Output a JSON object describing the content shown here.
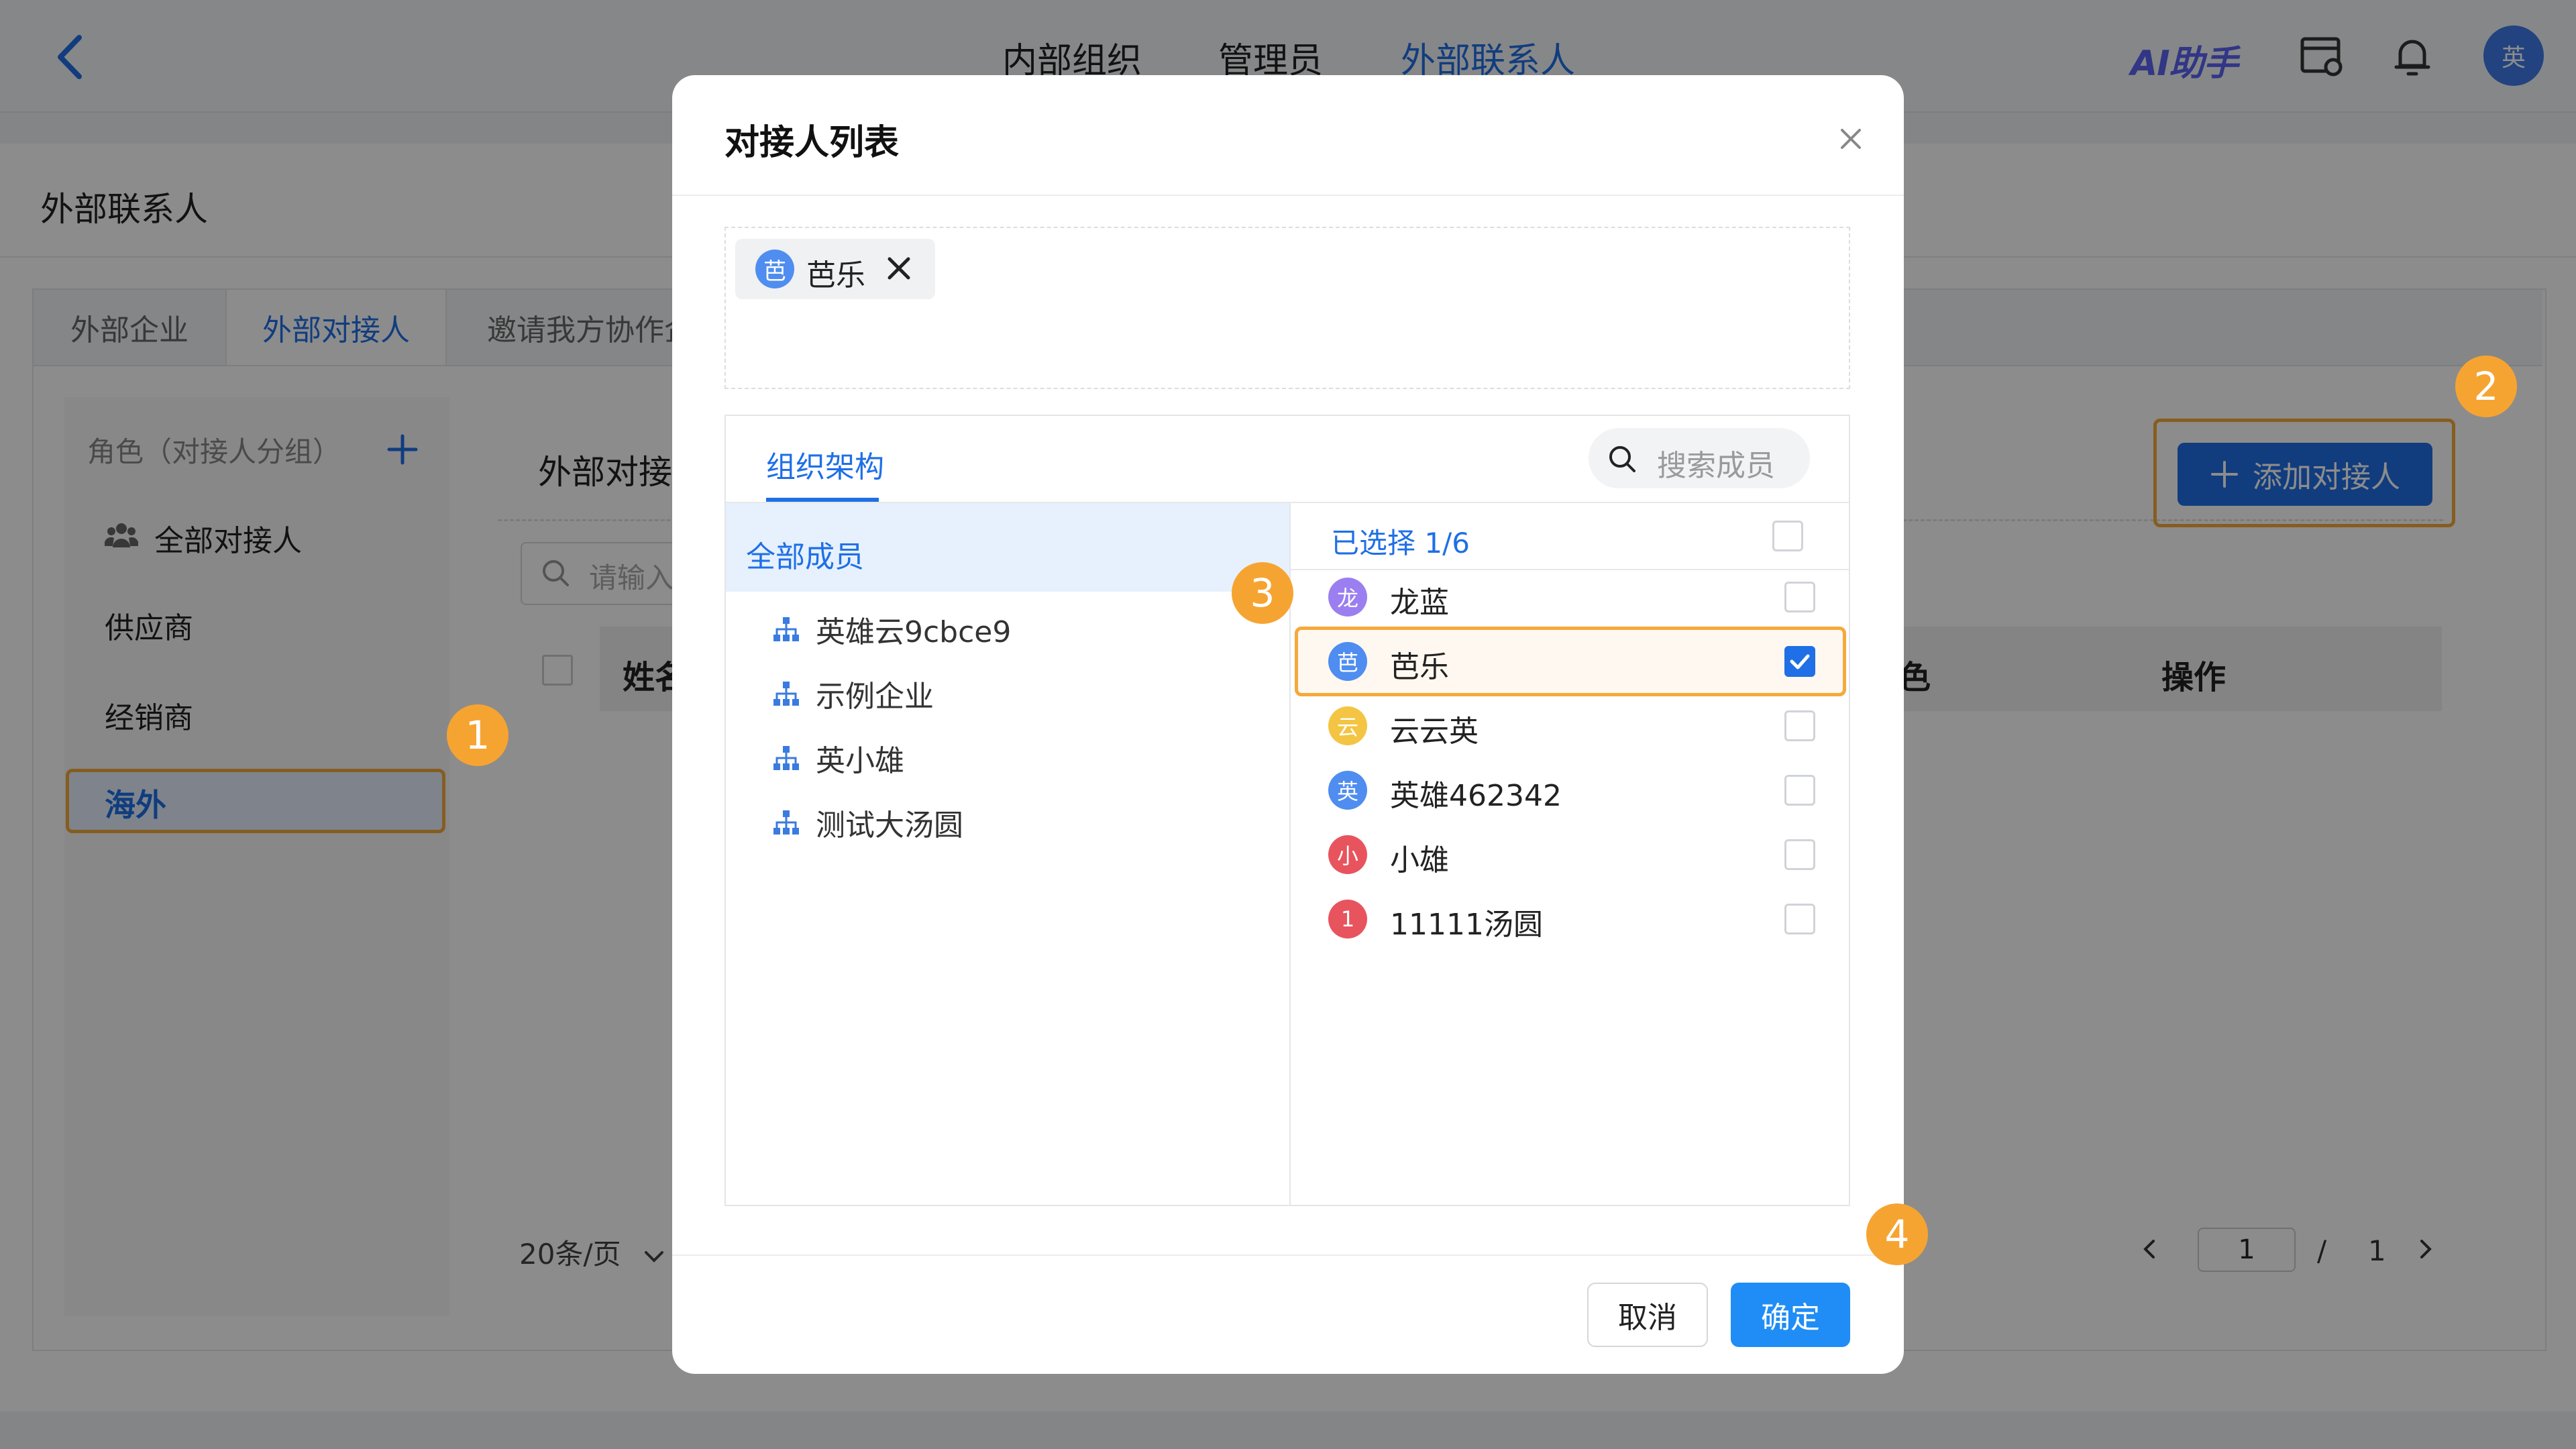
{
  "topnav": {
    "tabs": [
      {
        "label": "内部组织"
      },
      {
        "label": "管理员"
      },
      {
        "label": "外部联系人"
      }
    ],
    "ai_label": "AI助手",
    "avatar": "英"
  },
  "page": {
    "title": "外部联系人",
    "subtabs": [
      "外部企业",
      "外部对接人",
      "邀请我方协作企"
    ],
    "roles_header": "角色（对接人分组）",
    "roles": [
      "全部对接人",
      "供应商",
      "经销商",
      "海外"
    ],
    "content_title": "外部对接人",
    "search_placeholder": "请输入",
    "table_headers": [
      "姓名",
      "色",
      "操作"
    ],
    "add_button": "添加对接人",
    "page_size": "20条/页",
    "pager": {
      "current": "1",
      "separator": "/",
      "total": "1"
    }
  },
  "badges": [
    "1",
    "2",
    "3",
    "4"
  ],
  "modal": {
    "title": "对接人列表",
    "selected_chips": [
      {
        "avatar": "芭",
        "name": "芭乐"
      }
    ],
    "org_tab": "组织架构",
    "search_placeholder": "搜索成员",
    "all_members": "全部成员",
    "org_items": [
      "英雄云9cbce9",
      "示例企业",
      "英小雄",
      "测试大汤圆"
    ],
    "selected_count": "已选择 1/6",
    "members": [
      {
        "avatar": "龙",
        "name": "龙蓝",
        "color": "#9b7ff0",
        "checked": false
      },
      {
        "avatar": "芭",
        "name": "芭乐",
        "color": "#4f8df0",
        "checked": true
      },
      {
        "avatar": "云",
        "name": "云云英",
        "color": "#f4c542",
        "checked": false
      },
      {
        "avatar": "英",
        "name": "英雄462342",
        "color": "#4f8df0",
        "checked": false
      },
      {
        "avatar": "小",
        "name": "小雄",
        "color": "#e8545e",
        "checked": false
      },
      {
        "avatar": "1",
        "name": "11111汤圆",
        "color": "#e8545e",
        "checked": false
      }
    ],
    "cancel_label": "取消",
    "ok_label": "确定"
  },
  "colors": {
    "primary": "#1f6fe6",
    "highlight": "#f5a93b",
    "badge": "#f6a431"
  }
}
